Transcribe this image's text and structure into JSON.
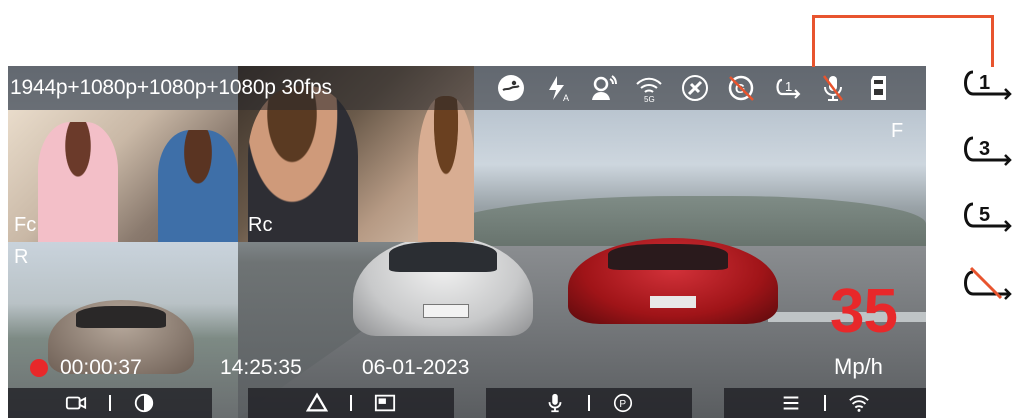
{
  "status_bar": {
    "resolution_text": "1944p+1080p+1080p+1080p 30fps",
    "icons": [
      "swim-icon",
      "flash-auto-icon",
      "voice-control-icon",
      "wifi-5g-icon",
      "gps-icon",
      "gsensor-off-icon",
      "loop-1-icon",
      "mic-off-icon",
      "sd-card-icon"
    ],
    "loop_label": "1"
  },
  "views": {
    "front_label": "F",
    "front_cabin_label": "Fc",
    "rear_cabin_label": "Rc",
    "rear_label": "R"
  },
  "speed": {
    "value": "35",
    "unit": "Mp/h"
  },
  "info": {
    "record_time": "00:00:37",
    "clock": "14:25:35",
    "date": "06-01-2023"
  },
  "toolbar": {
    "groups": [
      [
        "camera-icon",
        "contrast-icon"
      ],
      [
        "emergency-lock-icon",
        "picture-in-picture-icon"
      ],
      [
        "microphone-icon",
        "parking-icon"
      ],
      [
        "menu-icon",
        "wifi-icon"
      ]
    ]
  },
  "loop_legend": {
    "items": [
      {
        "label": "1",
        "icon": "loop-1-icon"
      },
      {
        "label": "3",
        "icon": "loop-3-icon"
      },
      {
        "label": "5",
        "icon": "loop-5-icon"
      },
      {
        "label": "",
        "icon": "loop-off-icon"
      }
    ]
  },
  "colors": {
    "accent": "#e8542e",
    "speed": "#e8282a",
    "recording": "#e8282a"
  }
}
